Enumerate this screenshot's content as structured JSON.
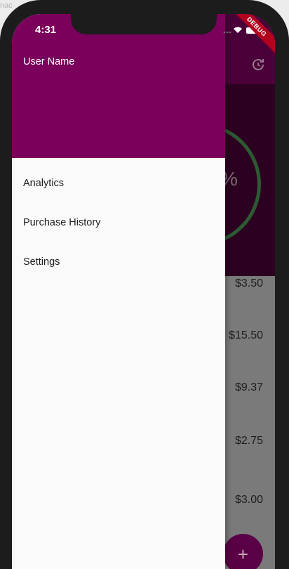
{
  "page_label": "nac",
  "status_bar": {
    "time": "4:31"
  },
  "debug_banner": "DEBUG",
  "drawer": {
    "user_name": "User Name",
    "items": [
      {
        "label": "Analytics"
      },
      {
        "label": "Purchase History"
      },
      {
        "label": "Settings"
      }
    ]
  },
  "background_app": {
    "percent_fragment": "%",
    "amounts": [
      "$3.50",
      "$15.50",
      "$9.37",
      "$2.75",
      "$3.00"
    ],
    "fab_label": "+"
  },
  "colors": {
    "drawer_header": "#7a005c",
    "fab": "#5a0046",
    "progress_ring": "#2d5a33"
  }
}
